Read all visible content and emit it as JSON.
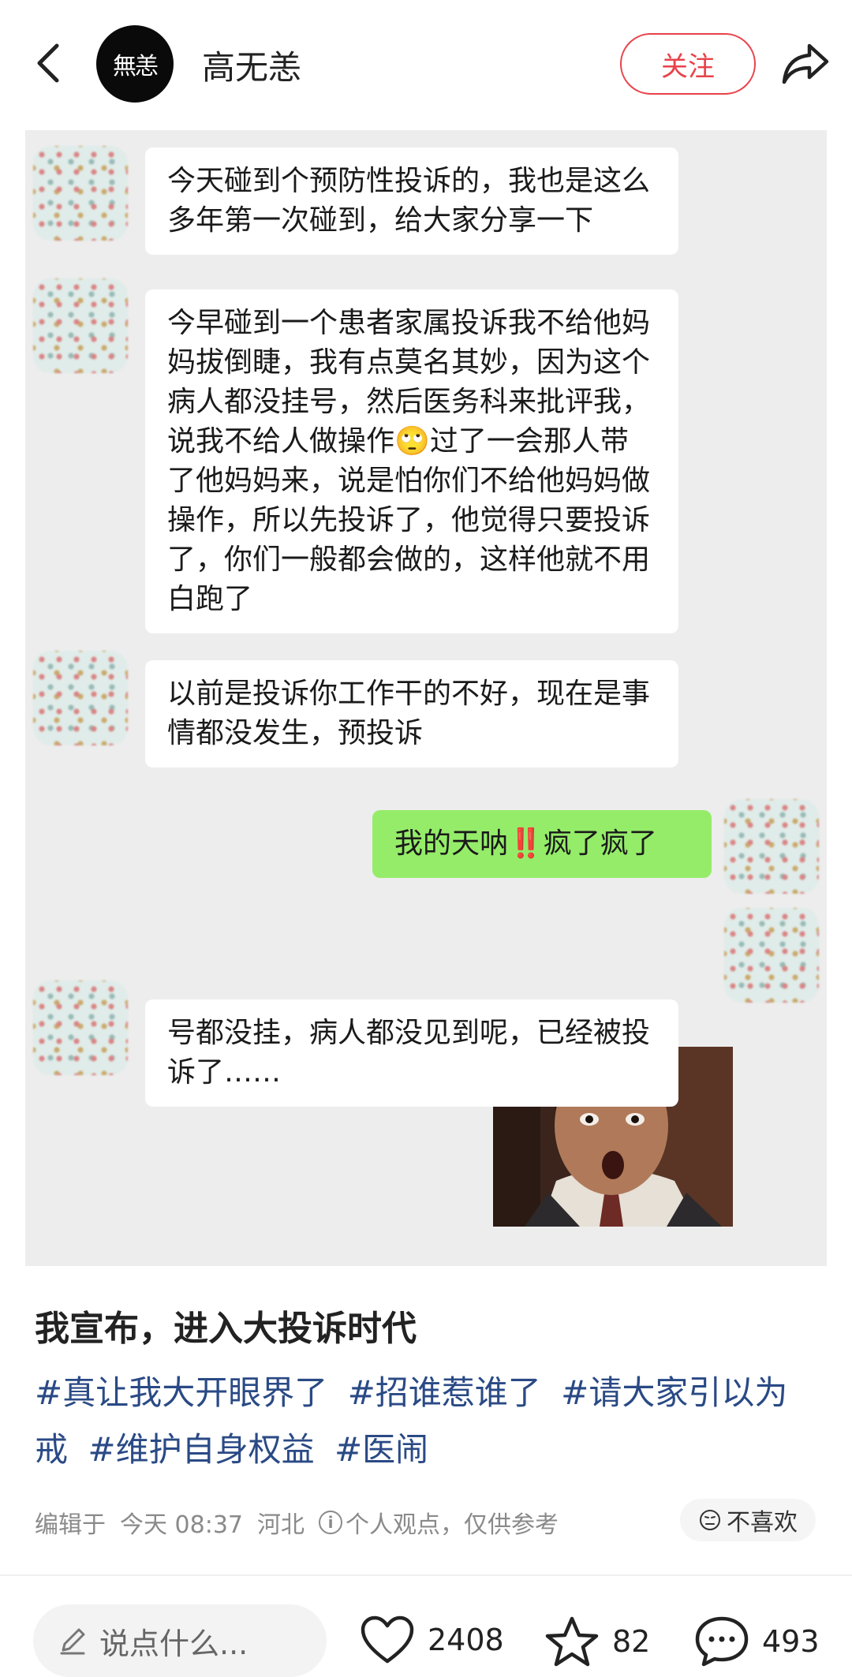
{
  "header": {
    "back_icon": "chevron-left-icon",
    "avatar_text": "無恙",
    "author_name": "高无恙",
    "follow_label": "关注",
    "share_icon": "share-arrow-icon"
  },
  "chat": {
    "messages": [
      {
        "side": "left",
        "text": "今天碰到个预防性投诉的，我也是这么多年第一次碰到，给大家分享一下"
      },
      {
        "side": "left",
        "text": "今早碰到一个患者家属投诉我不给他妈妈拔倒睫，我有点莫名其妙，因为这个病人都没挂号，然后医务科来批评我，说我不给人做操作🙄过了一会那人带了他妈妈来，说是怕你们不给他妈妈做操作，所以先投诉了，他觉得只要投诉了，你们一般都会做的，这样他就不用白跑了"
      },
      {
        "side": "left",
        "text": "以前是投诉你工作干的不好，现在是事情都没发生，预投诉"
      },
      {
        "side": "right",
        "text": "我的天呐‼️疯了疯了"
      },
      {
        "side": "left",
        "text": "号都没挂，病人都没见到呢，已经被投诉了……"
      }
    ]
  },
  "post": {
    "title": "我宣布，进入大投诉时代",
    "tags": [
      "#真让我大开眼界了",
      "#招谁惹谁了",
      "#请大家引以为戒",
      "#维护自身权益",
      "#医闹"
    ],
    "edited_prefix": "编辑于",
    "edited_time": "今天 08:37",
    "location": "河北",
    "disclaimer": "个人观点，仅供参考",
    "dislike_label": "不喜欢"
  },
  "bottom_bar": {
    "comment_placeholder": "说点什么...",
    "likes": "2408",
    "favorites": "82",
    "comments": "493"
  },
  "colors": {
    "follow_red": "#e8424a",
    "tag_blue": "#2a4a85",
    "chat_bg": "#ededed",
    "wechat_green": "#95ec69"
  }
}
